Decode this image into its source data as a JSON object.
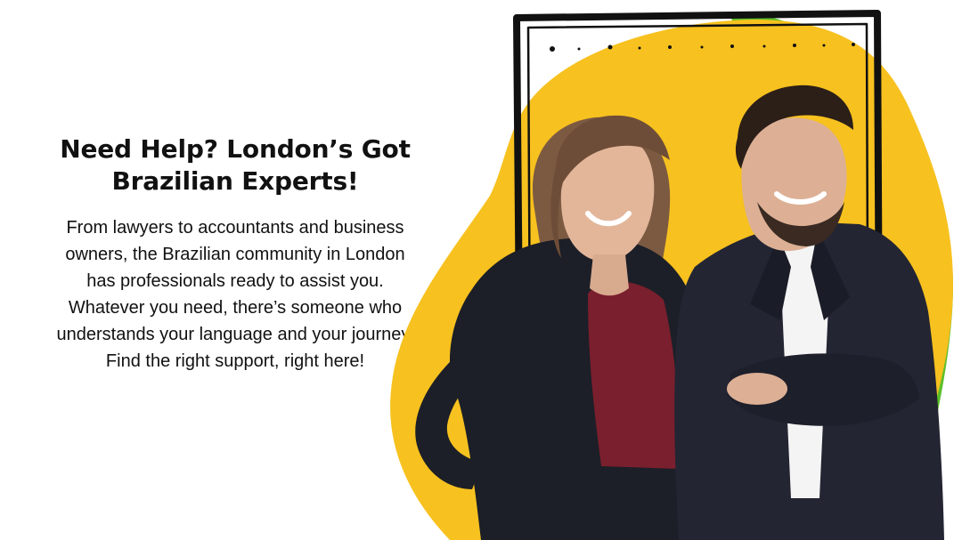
{
  "hero": {
    "headline": "Need Help? London’s Got Brazilian Experts!",
    "body": "From lawyers to accountants and business owners, the Brazilian community in London has professionals ready to assist you. Whatever you need, there’s someone who understands your language and your journey. Find the right support, right here!"
  },
  "colors": {
    "background": "#ffffff",
    "text": "#111111",
    "accent_yellow": "#f7c11f",
    "accent_green": "#5dbf2a",
    "frame_black": "#111111",
    "woman_top": "#7a1f2d",
    "jacket_dark": "#1f2431",
    "man_suit": "#232533",
    "shirt": "#f4f4f4",
    "skin": "#e3b69a",
    "hair_brown": "#7c5a42",
    "hair_dark": "#2b1f18"
  },
  "icons": {
    "decorative_frame": "hand-drawn-frame-icon",
    "accent_blob": "yellow-blob-icon"
  }
}
